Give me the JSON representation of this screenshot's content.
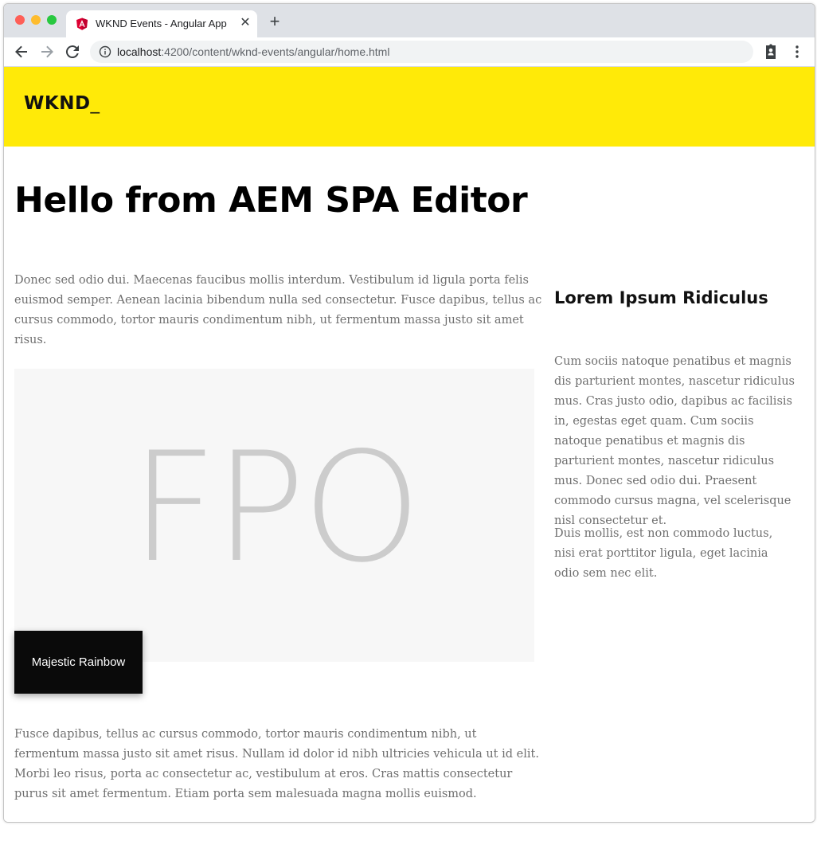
{
  "browser": {
    "tab_title": "WKND Events - Angular App",
    "tab_close": "✕",
    "new_tab": "+",
    "url_host": "localhost",
    "url_path": ":4200/content/wknd-events/angular/home.html"
  },
  "site": {
    "logo": "WKND",
    "logo_cursor": "_",
    "hero_title": "Hello from AEM SPA Editor",
    "intro_text": "Donec sed odio dui. Maecenas faucibus mollis interdum. Vestibulum id ligula porta felis euismod semper. Aenean lacinia bibendum nulla sed consectetur. Fusce dapibus, tellus ac cursus commodo, tortor mauris condimentum nibh, ut fermentum massa justo sit amet risus.",
    "image_placeholder": "FPO",
    "image_caption": "Majestic Rainbow",
    "body_text": "Fusce dapibus, tellus ac cursus commodo, tortor mauris condimentum nibh, ut fermentum massa justo sit amet risus. Nullam id dolor id nibh ultricies vehicula ut id elit. Morbi leo risus, porta ac consectetur ac, vestibulum at eros. Cras mattis consectetur purus sit amet fermentum. Etiam porta sem malesuada magna mollis euismod.",
    "sidebar": {
      "title": "Lorem Ipsum Ridiculus",
      "para1": "Cum sociis natoque penatibus et magnis dis parturient montes, nascetur ridiculus mus. Cras justo odio, dapibus ac facilisis in, egestas eget quam. Cum sociis natoque penatibus et magnis dis parturient montes, nascetur ridiculus mus. Donec sed odio dui. Praesent commodo cursus magna, vel scelerisque nisl consectetur et.",
      "para2": "Duis mollis, est non commodo luctus, nisi erat porttitor ligula, eget lacinia odio sem nec elit."
    }
  },
  "colors": {
    "header_bg": "#ffea08",
    "caption_bg": "#0a0a0a",
    "placeholder_bg": "#f7f7f7"
  }
}
